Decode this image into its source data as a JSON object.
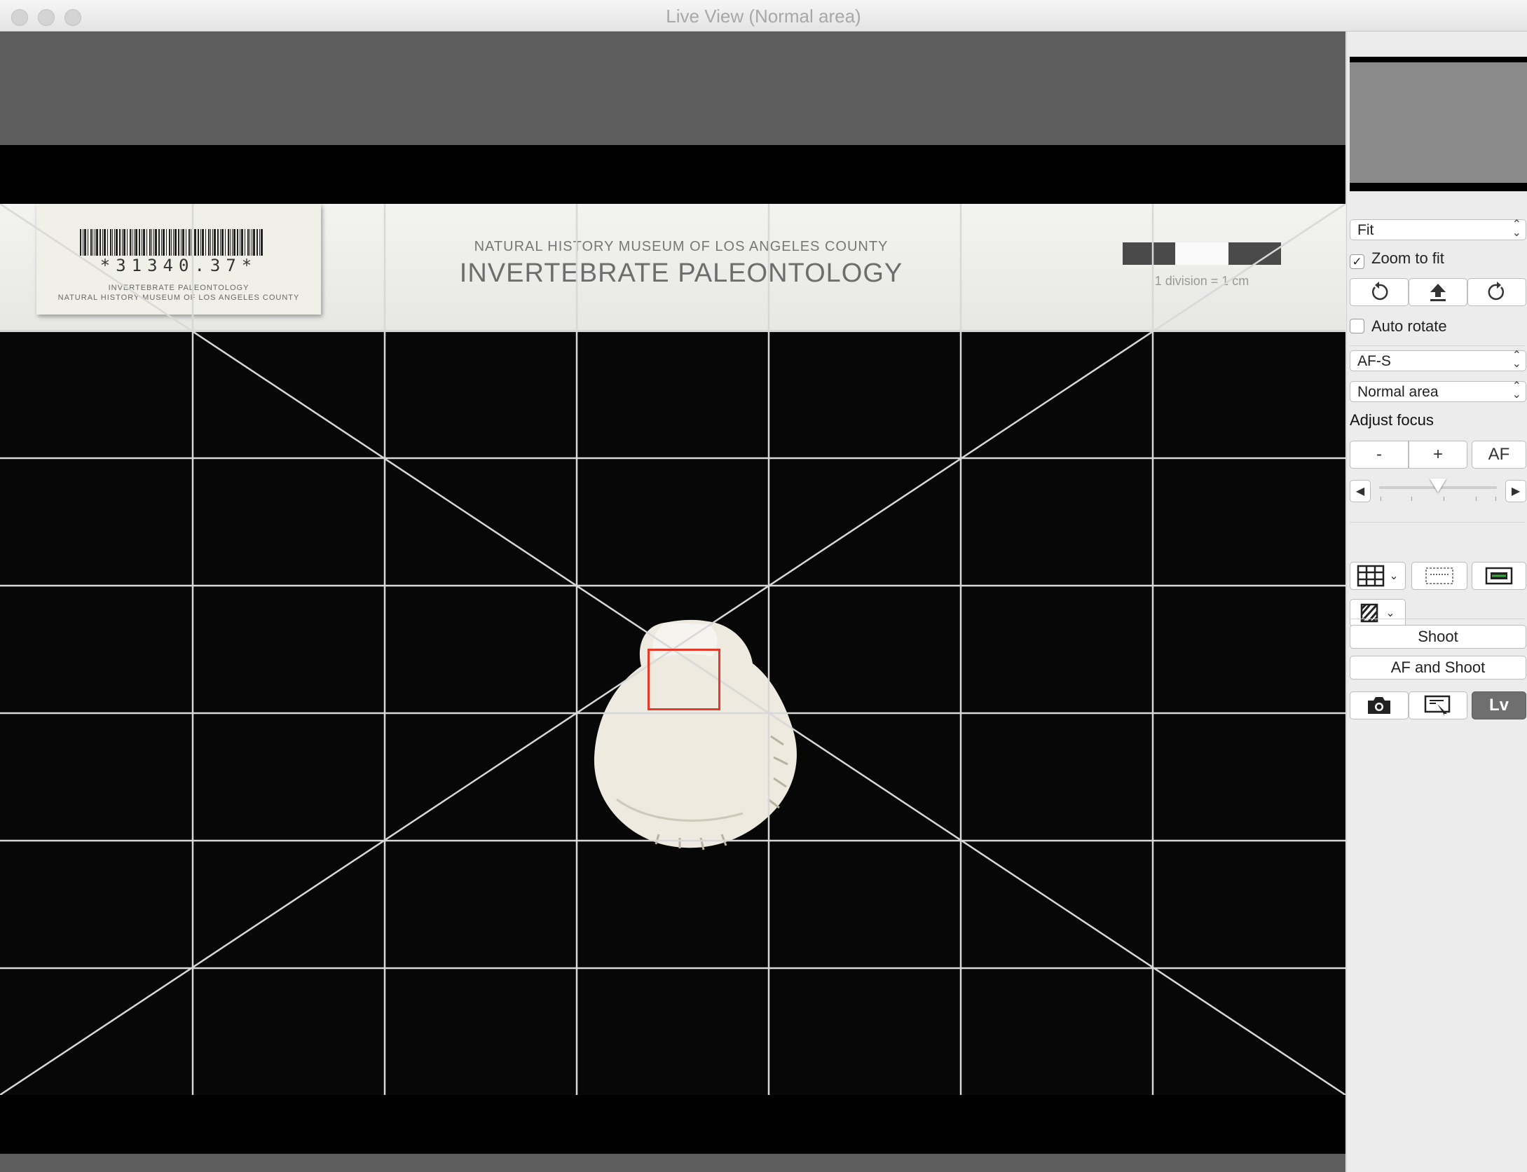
{
  "window": {
    "title": "Live View (Normal area)"
  },
  "specimen_label": {
    "barcode_number": "*31340.37*",
    "barcode_caption_1": "INVERTEBRATE PALEONTOLOGY",
    "barcode_caption_2": "NATURAL HISTORY MUSEUM OF LOS ANGELES COUNTY",
    "museum_name": "NATURAL HISTORY MUSEUM OF LOS ANGELES COUNTY",
    "department": "INVERTEBRATE PALEONTOLOGY",
    "scale_caption": "1 division = 1 cm"
  },
  "panel": {
    "zoom_select": "Fit",
    "zoom_to_fit": {
      "label": "Zoom to fit",
      "checked": true
    },
    "rotate_left_icon": "rotate-left-icon",
    "upload_icon": "upload-icon",
    "rotate_right_icon": "rotate-right-icon",
    "auto_rotate": {
      "label": "Auto rotate",
      "checked": false
    },
    "af_mode_select": "AF-S",
    "af_area_select": "Normal area",
    "adjust_focus_label": "Adjust focus",
    "focus_minus": "-",
    "focus_plus": "+",
    "focus_af": "AF",
    "focus_slider_level": 0.5,
    "grid_icon": "grid-icon",
    "focus_peaking_icon": "focus-peaking-icon",
    "overlay_icon": "overlay-icon",
    "exposure_sim_icon": "exposure-simulation-icon",
    "shoot_label": "Shoot",
    "af_shoot_label": "AF and Shoot",
    "camera_icon": "camera-icon",
    "screen_icon": "screen-icon",
    "lv_label": "Lv"
  },
  "colors": {
    "af_frame": "#e53a2a",
    "lv_active": "#6f6f6f"
  }
}
